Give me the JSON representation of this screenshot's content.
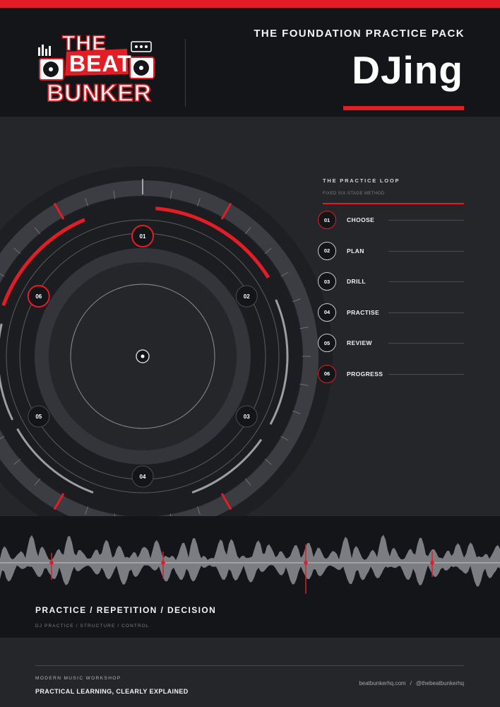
{
  "brand": {
    "logo_line1": "THE",
    "logo_line2": "BEAT",
    "logo_line3": "BUNKER",
    "accent_color": "#e21d25"
  },
  "header": {
    "pack_title": "THE FOUNDATION PRACTICE PACK",
    "main_title": "DJing"
  },
  "practice_loop": {
    "title": "THE PRACTICE LOOP",
    "subtitle": "FIXED SIX-STAGE METHOD",
    "items": [
      {
        "num": "01",
        "label": "CHOOSE"
      },
      {
        "num": "02",
        "label": "PLAN"
      },
      {
        "num": "03",
        "label": "DRILL"
      },
      {
        "num": "04",
        "label": "PRACTISE"
      },
      {
        "num": "05",
        "label": "REVIEW"
      },
      {
        "num": "06",
        "label": "PROGRESS"
      }
    ]
  },
  "dial": {
    "stages": [
      "01",
      "02",
      "03",
      "04",
      "05",
      "06"
    ]
  },
  "tagline": {
    "main": "PRACTICE / REPETITION / DECISION",
    "sub": "DJ PRACTICE / STRUCTURE / CONTROL"
  },
  "footer": {
    "kicker": "MODERN MUSIC WORKSHOP",
    "headline": "PRACTICAL LEARNING, CLEARLY EXPLAINED",
    "website": "beatbunkerhq.com",
    "separator": "/",
    "handle": "@thebeatbunkerhq"
  }
}
